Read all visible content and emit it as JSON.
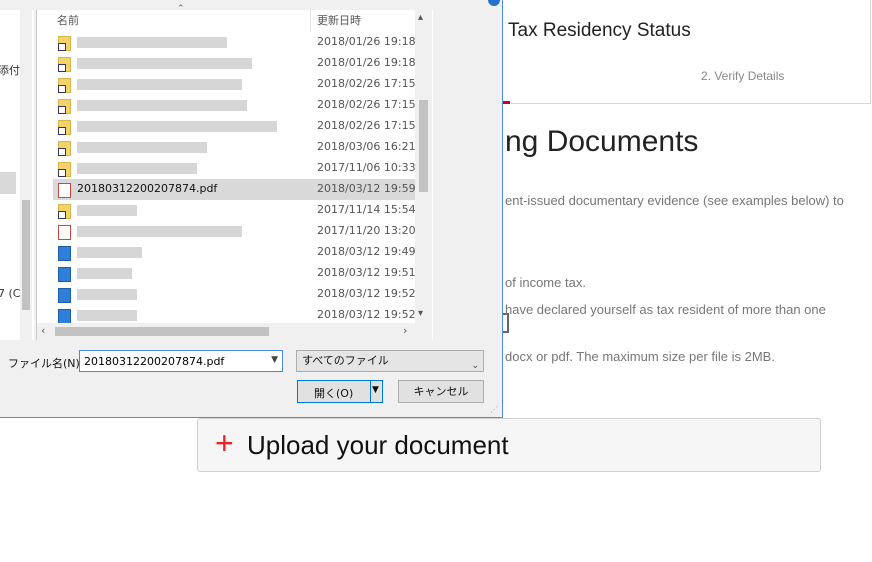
{
  "webpage": {
    "header_title": "Tax Residency Status",
    "header_step": "2. Verify Details",
    "section_heading": "ng Documents",
    "paragraphs": [
      "ent-issued documentary evidence (see examples below) to",
      "of income tax.",
      "have declared yourself as tax resident of more than one",
      "docx or pdf. The maximum size per file is 2MB."
    ],
    "upload_plus": "+",
    "upload_label": "Upload your document"
  },
  "dialog": {
    "sidebar_fragments": [
      "添付フ",
      "7 (C"
    ],
    "columns": {
      "name": "名前",
      "modified": "更新日時"
    },
    "files": [
      {
        "type": "folder",
        "name": "",
        "date": "2018/01/26 19:18",
        "selected": false
      },
      {
        "type": "folder",
        "name": "",
        "date": "2018/01/26 19:18",
        "selected": false
      },
      {
        "type": "folder",
        "name": "",
        "date": "2018/02/26 17:15",
        "selected": false
      },
      {
        "type": "folder",
        "name": "",
        "date": "2018/02/26 17:15",
        "selected": false
      },
      {
        "type": "folder",
        "name": "",
        "date": "2018/02/26 17:15",
        "selected": false
      },
      {
        "type": "folder",
        "name": "",
        "date": "2018/03/06 16:21",
        "selected": false
      },
      {
        "type": "folder",
        "name": "",
        "date": "2017/11/06 10:33",
        "selected": false
      },
      {
        "type": "pdf",
        "name": "20180312200207874.pdf",
        "date": "2018/03/12 19:59",
        "selected": true
      },
      {
        "type": "folder",
        "name": "",
        "date": "2017/11/14 15:54",
        "selected": false
      },
      {
        "type": "pdf",
        "name": "",
        "date": "2017/11/20 13:20",
        "selected": false
      },
      {
        "type": "img",
        "name": "",
        "date": "2018/03/12 19:49",
        "selected": false
      },
      {
        "type": "img",
        "name": "",
        "date": "2018/03/12 19:51",
        "selected": false
      },
      {
        "type": "img",
        "name": "",
        "date": "2018/03/12 19:52",
        "selected": false
      },
      {
        "type": "img",
        "name": "",
        "date": "2018/03/12 19:52",
        "selected": false
      }
    ],
    "filename_label": "ファイル名(N):",
    "filename_value": "20180312200207874.pdf",
    "filetype_value": "すべてのファイル",
    "open_label": "開く(O)",
    "cancel_label": "キャンセル"
  },
  "colors": {
    "accent": "#0078d7",
    "upload_plus": "#e22222",
    "selection": "#d9d9d9"
  }
}
